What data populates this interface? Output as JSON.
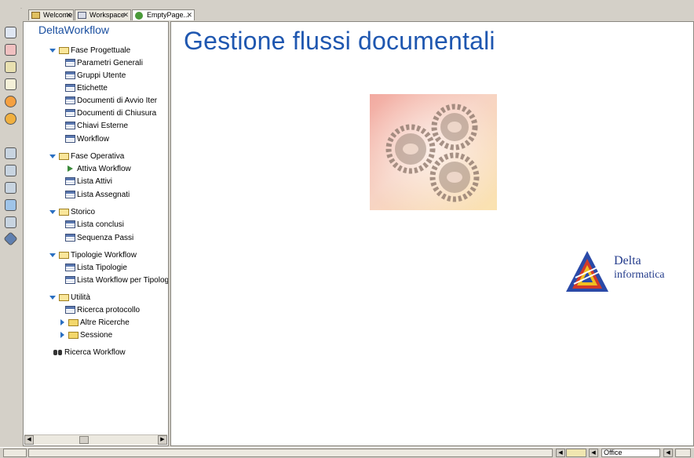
{
  "tabs": [
    {
      "label": "Welcome",
      "icon": "home-icon",
      "closable": true,
      "active": false
    },
    {
      "label": "Workspace",
      "icon": "workspace-icon",
      "closable": true,
      "active": false
    },
    {
      "label": "EmptyPage...",
      "icon": "page-icon",
      "closable": true,
      "active": true
    }
  ],
  "tree": {
    "title": "DeltaWorkflow",
    "nodes": [
      {
        "label": "Fase Progettuale",
        "type": "folder",
        "expanded": true
      },
      {
        "label": "Parametri Generali",
        "type": "table"
      },
      {
        "label": "Gruppi Utente",
        "type": "table"
      },
      {
        "label": "Etichette",
        "type": "table"
      },
      {
        "label": "Documenti di Avvio Iter",
        "type": "table"
      },
      {
        "label": "Documenti di Chiusura",
        "type": "table"
      },
      {
        "label": "Chiavi Esterne",
        "type": "table"
      },
      {
        "label": "Workflow",
        "type": "table"
      },
      {
        "label": "Fase Operativa",
        "type": "folder",
        "expanded": true
      },
      {
        "label": "Attiva Workflow",
        "type": "action"
      },
      {
        "label": "Lista Attivi",
        "type": "table"
      },
      {
        "label": "Lista Assegnati",
        "type": "table"
      },
      {
        "label": "Storico",
        "type": "folder",
        "expanded": true
      },
      {
        "label": "Lista conclusi",
        "type": "table"
      },
      {
        "label": "Sequenza Passi",
        "type": "table"
      },
      {
        "label": "Tipologie Workflow",
        "type": "folder",
        "expanded": true
      },
      {
        "label": "Lista Tipologie",
        "type": "table"
      },
      {
        "label": "Lista Workflow per Tipologia",
        "type": "table"
      },
      {
        "label": "Utilità",
        "type": "folder",
        "expanded": true
      },
      {
        "label": "Ricerca protocollo",
        "type": "table"
      },
      {
        "label": "Altre Ricerche",
        "type": "folder",
        "expanded": false
      },
      {
        "label": "Sessione",
        "type": "folder",
        "expanded": false
      },
      {
        "label": "Ricerca Workflow",
        "type": "search"
      }
    ]
  },
  "main": {
    "title": "Gestione flussi documentali",
    "logo_line1": "Delta",
    "logo_line2": "informatica"
  },
  "status": {
    "theme": "Office"
  },
  "colors": {
    "title_blue": "#1f57b0",
    "tree_title": "#1a4fa0",
    "logo_blue": "#243c8c"
  }
}
